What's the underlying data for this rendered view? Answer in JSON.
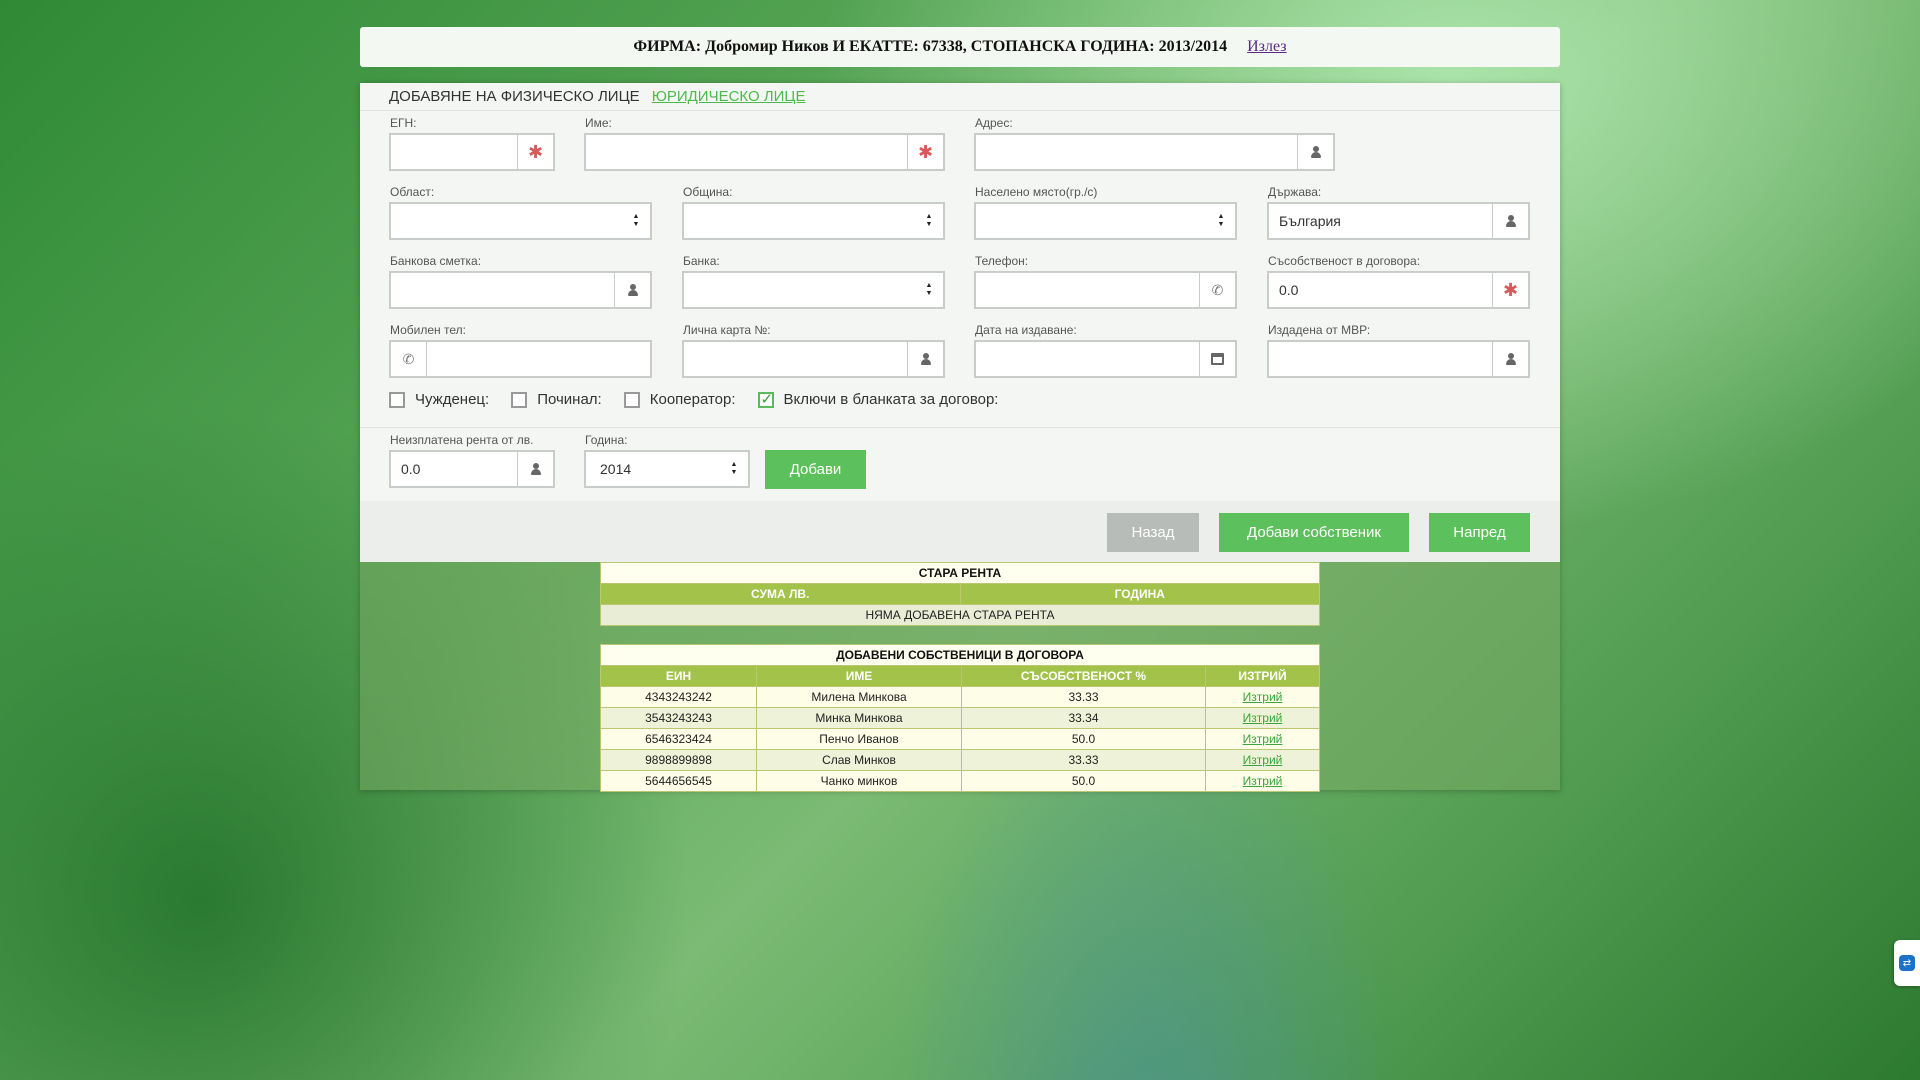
{
  "header": {
    "firm_text": "ФИРМА: Добромир Ников И ЕКАТТЕ: 67338, СТОПАНСКА ГОДИНА: 2013/2014",
    "logout": "Излез"
  },
  "tabs": {
    "active": "ДОБАВЯНЕ НА ФИЗИЧЕСКО ЛИЦЕ",
    "link": "ЮРИДИЧЕСКО ЛИЦЕ"
  },
  "form": {
    "egn_label": "ЕГН:",
    "egn_value": "",
    "name_label": "Име:",
    "name_value": "",
    "address_label": "Адрес:",
    "address_value": "",
    "region_label": "Област:",
    "region_value": "",
    "municipality_label": "Община:",
    "municipality_value": "",
    "settlement_label": "Населено място(гр./с)",
    "settlement_value": "",
    "country_label": "Държава:",
    "country_value": "България",
    "bank_account_label": "Банкова сметка:",
    "bank_account_value": "",
    "bank_label": "Банка:",
    "bank_value": "",
    "phone_label": "Телефон:",
    "phone_value": "",
    "ownership_label": "Съсобственост в договора:",
    "ownership_value": "0.0",
    "mobile_label": "Мобилен тел:",
    "mobile_value": "",
    "id_card_label": "Лична карта №:",
    "id_card_value": "",
    "issue_date_label": "Дата на издаване:",
    "issue_date_value": "",
    "issued_by_label": "Издадена от МВР:",
    "issued_by_value": "",
    "checkboxes": [
      {
        "label": "Чужденец:",
        "checked": false
      },
      {
        "label": "Починал:",
        "checked": false
      },
      {
        "label": "Кооператор:",
        "checked": false
      },
      {
        "label": "Включи в бланката за договор:",
        "checked": true
      }
    ],
    "unpaid_rent_label": "Неизплатена рента от лв.",
    "unpaid_rent_value": "0.0",
    "year_label": "Година:",
    "year_value": "2014",
    "add_button": "Добави"
  },
  "buttons": {
    "back": "Назад",
    "add_owner": "Добави собственик",
    "next": "Напред"
  },
  "old_rent_table": {
    "title": "СТАРА РЕНТА",
    "columns": [
      "СУМА ЛВ.",
      "ГОДИНА"
    ],
    "empty": "НЯМА ДОБАВЕНА СТАРА РЕНТА"
  },
  "owners_table": {
    "title": "ДОБАВЕНИ СОБСТВЕНИЦИ В ДОГОВОРА",
    "columns": [
      "ЕИН",
      "ИМЕ",
      "СЪСОБСТВЕНОСТ %",
      "ИЗТРИЙ"
    ],
    "rows": [
      {
        "ein": "4343243242",
        "name": "Милена Минкова",
        "share": "33.33",
        "action": "Изтрий"
      },
      {
        "ein": "3543243243",
        "name": "Минка Минкова",
        "share": "33.34",
        "action": "Изтрий"
      },
      {
        "ein": "6546323424",
        "name": "Пенчо Иванов",
        "share": "50.0",
        "action": "Изтрий"
      },
      {
        "ein": "9898899898",
        "name": "Слав Минков",
        "share": "33.33",
        "action": "Изтрий"
      },
      {
        "ein": "5644656545",
        "name": "Чанко минков",
        "share": "50.0",
        "action": "Изтрий"
      }
    ]
  },
  "colors": {
    "accent": "#5cc05c",
    "table_header": "#a2c24a",
    "required": "#d65a5a"
  },
  "icons": [
    "asterisk-icon",
    "person-icon",
    "phone-icon",
    "calendar-icon",
    "sort-caret-icon",
    "teamviewer-icon"
  ]
}
